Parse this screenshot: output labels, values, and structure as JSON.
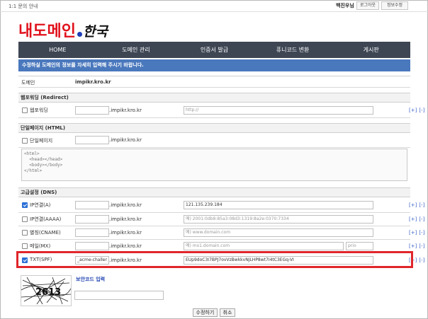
{
  "topbar": {
    "help_label": "1:1 문의 안내",
    "greeting": "백진우님",
    "logout_label": "로그아웃",
    "edit_info_label": "정보수정"
  },
  "logo": {
    "text_red": "내도메인",
    "text_black": "한국"
  },
  "nav": [
    "HOME",
    "도메인 관리",
    "인증서 발급",
    "퓨니코드 변환",
    "게시판"
  ],
  "notice": "수정하실 도메인의 정보를 자세히 입력해 주시기 바랍니다.",
  "domain": {
    "label": "도메인",
    "value": "impikr.kro.kr"
  },
  "redirect": {
    "section_title": "웹포워딩 (Redirect)",
    "row_label": "웹포워딩",
    "suffix": ".impikr.kro.kr",
    "target_placeholder": "http://",
    "checked": false
  },
  "single_page": {
    "section_title": "단일페이지 (HTML)",
    "row_label": "단일페이지",
    "suffix": ".impikr.kro.kr",
    "html_placeholder": "<html>\n  <head></head>\n  <body></body>\n</html>",
    "checked": false
  },
  "dns": {
    "section_title": "고급설정 (DNS)",
    "suffix": ".impikr.kro.kr",
    "records": [
      {
        "label": "IP연결(A)",
        "checked": true,
        "host": "",
        "value": "121.135.239.184",
        "is_placeholder": false
      },
      {
        "label": "IP연결(AAAA)",
        "checked": false,
        "host": "",
        "value": "예) 2001:0db8:85a3:08d3:1319:8a2e:0370:7334",
        "is_placeholder": true
      },
      {
        "label": "별칭(CNAME)",
        "checked": false,
        "host": "",
        "value": "예) www.domain.com",
        "is_placeholder": true
      },
      {
        "label": "메일(MX)",
        "checked": false,
        "host": "",
        "value": "예) mx1.domain.com",
        "is_placeholder": true,
        "priority_placeholder": "prio"
      },
      {
        "label": "TXT(SPF)",
        "checked": true,
        "host": "_acme-challer",
        "value": "EUp9doC3I7BPJ7ovVzBwkkvNJLHP8wt7I4tC3EGq-VI",
        "is_placeholder": false
      }
    ]
  },
  "actions": {
    "add": "[+]",
    "remove": "[-]"
  },
  "captcha": {
    "label": "보안코드 입력",
    "code_text": "2613"
  },
  "buttons": {
    "submit": "수정하기",
    "cancel": "취소"
  },
  "colors": {
    "nav_bg": "#3e4654",
    "notice_bg": "#4a78bd",
    "logo_red": "#e0111b",
    "highlight": "#e0262b",
    "link_blue": "#3a62c7"
  }
}
